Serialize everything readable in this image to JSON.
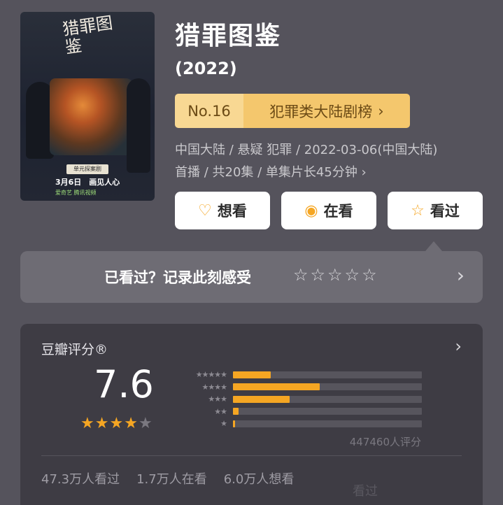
{
  "poster": {
    "title_art": "猎罪图鉴",
    "tag": "单元探案剧",
    "date": "3月6日　画见人心",
    "logos": "爱奇艺 腾讯视频"
  },
  "title": "猎罪图鉴",
  "year": "(2022)",
  "rank": {
    "number": "No.16",
    "list_name": "犯罪类大陆剧榜",
    "chevron": "›"
  },
  "meta": {
    "line1": "中国大陆 / 悬疑 犯罪 / 2022-03-06(中国大陆)",
    "line2": "首播 / 共20集 / 单集片长45分钟 ›"
  },
  "actions": [
    {
      "label": "想看",
      "icon": "heart-plus-icon",
      "glyph": "♡"
    },
    {
      "label": "在看",
      "icon": "circle-dot-icon",
      "glyph": "◉"
    },
    {
      "label": "看过",
      "icon": "star-outline-icon",
      "glyph": "☆"
    }
  ],
  "record": {
    "prompt": "已看过？记录此刻感受",
    "stars": "☆☆☆☆☆",
    "chevron": "›"
  },
  "rating": {
    "label": "豆瓣评分®",
    "chevron": "›",
    "score": "7.6",
    "stars_filled": 4,
    "stars_total": 5,
    "distribution": [
      {
        "stars": "★★★★★",
        "fraction": 0.2
      },
      {
        "stars": "★★★★",
        "fraction": 0.46
      },
      {
        "stars": "★★★",
        "fraction": 0.3
      },
      {
        "stars": "★★",
        "fraction": 0.03
      },
      {
        "stars": "★",
        "fraction": 0.01
      }
    ],
    "count_text": "447460人评分"
  },
  "stats": {
    "watched": "47.3万人看过",
    "watching": "1.7万人在看",
    "wish": "6.0万人想看"
  },
  "watermark": "看过"
}
